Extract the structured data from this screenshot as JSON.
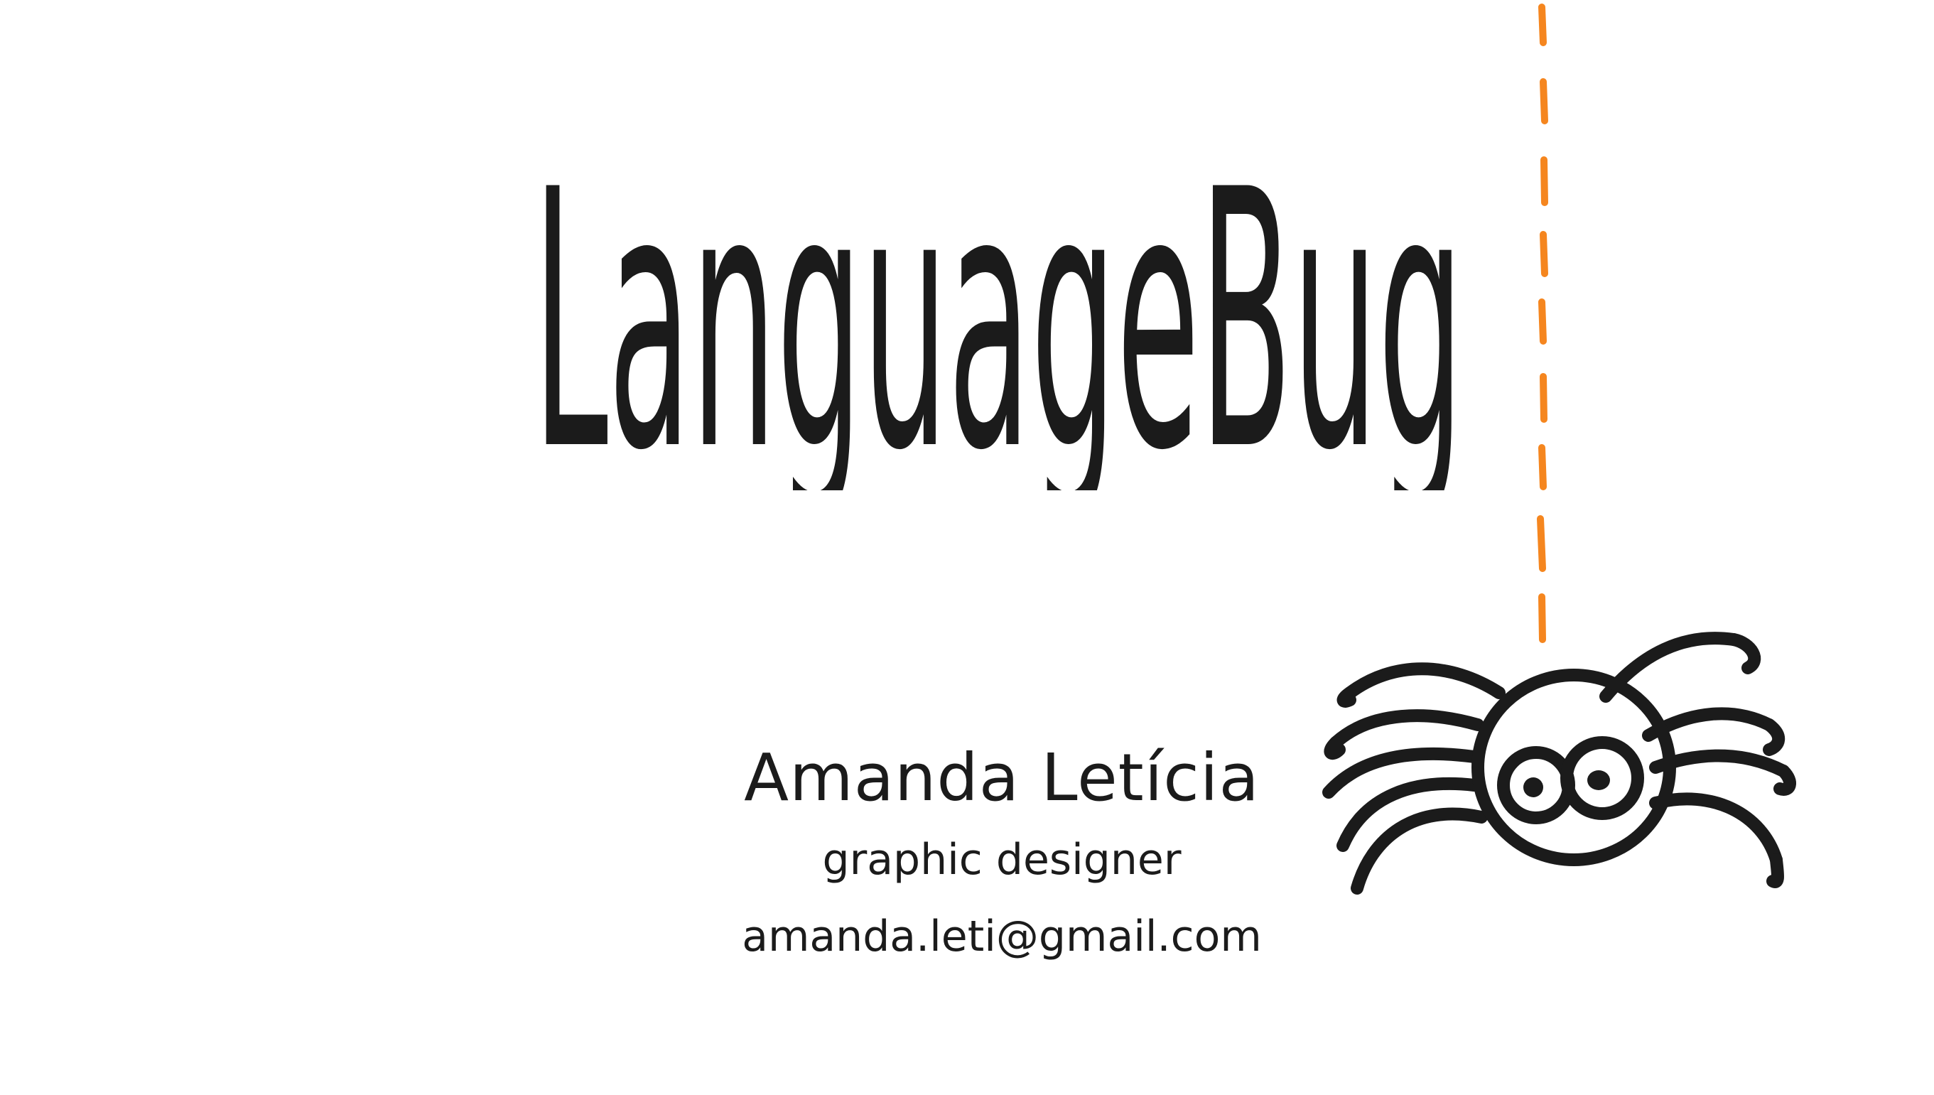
{
  "brand": {
    "name": "LanguageBug",
    "text_color": "#1b1b1b",
    "thread_color": "#f5861f"
  },
  "contact": {
    "name": "Amanda Letícia",
    "role": "graphic designer",
    "email": "amanda.leti@gmail.com"
  },
  "illustration": {
    "icon": "spider-icon"
  }
}
